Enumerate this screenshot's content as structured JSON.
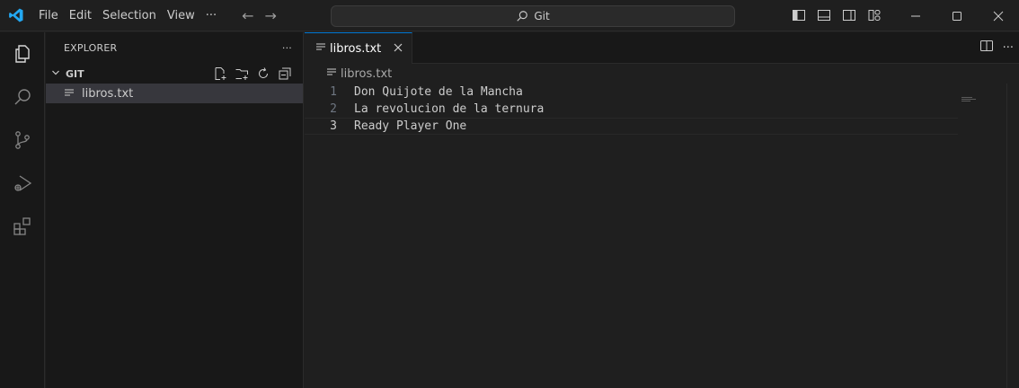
{
  "titlebar": {
    "menu": [
      "File",
      "Edit",
      "Selection",
      "View",
      "···"
    ],
    "search_text": "Git"
  },
  "explorer": {
    "title": "EXPLORER",
    "more": "···",
    "folder": "GIT",
    "files": [
      "libros.txt"
    ]
  },
  "editor": {
    "tab_label": "libros.txt",
    "breadcrumb": "libros.txt",
    "more": "···",
    "lines": [
      {
        "num": "1",
        "text": "Don Quijote de la Mancha"
      },
      {
        "num": "2",
        "text": "La revolucion de la ternura"
      },
      {
        "num": "3",
        "text": "Ready Player One"
      }
    ]
  },
  "colors": {
    "accent": "#0078d4",
    "vscode_blue": "#23a8f2"
  }
}
